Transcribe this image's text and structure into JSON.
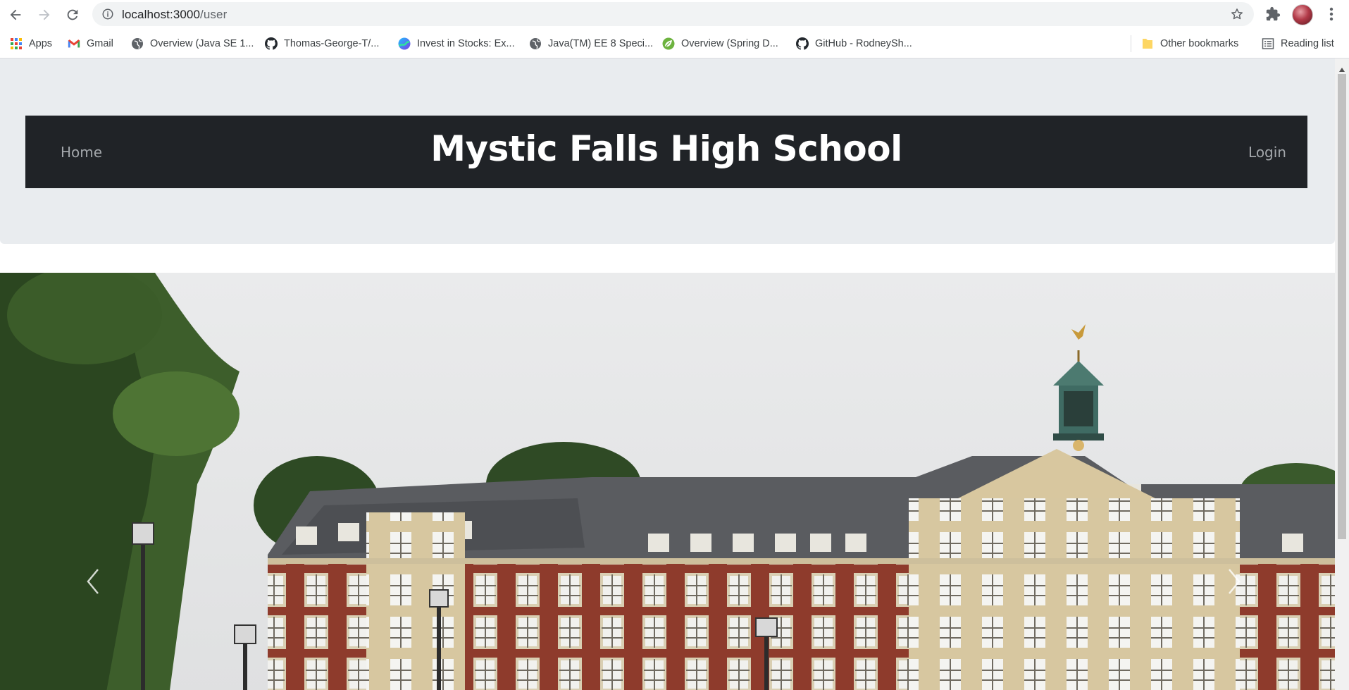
{
  "browser": {
    "url_host": "localhost:3000",
    "url_path": "/user",
    "bookmarks": [
      {
        "label": "Apps",
        "icon": "apps-grid-icon"
      },
      {
        "label": "Gmail",
        "icon": "gmail-icon"
      },
      {
        "label": "Overview (Java SE 1...",
        "icon": "globe-icon"
      },
      {
        "label": "Thomas-George-T/...",
        "icon": "github-icon"
      },
      {
        "label": "Invest in Stocks: Ex...",
        "icon": "stocks-icon"
      },
      {
        "label": "Java(TM) EE 8 Speci...",
        "icon": "globe-icon"
      },
      {
        "label": "Overview (Spring D...",
        "icon": "spring-leaf-icon"
      },
      {
        "label": "GitHub - RodneySh...",
        "icon": "github-icon"
      }
    ],
    "other_bookmarks": "Other bookmarks",
    "reading_list": "Reading list"
  },
  "navbar": {
    "home": "Home",
    "title": "Mystic Falls High School",
    "login": "Login"
  },
  "carousel": {
    "image": "school-building-photo"
  }
}
